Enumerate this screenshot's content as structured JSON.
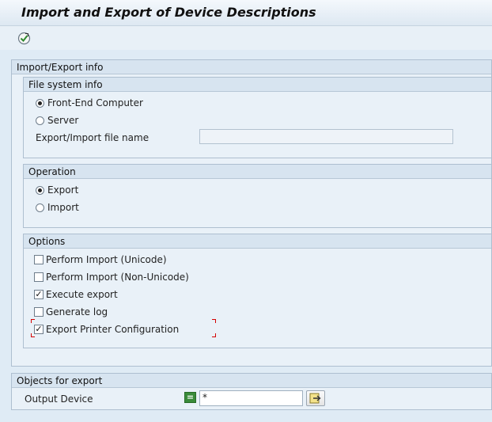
{
  "app": {
    "title": "Import and Export of Device Descriptions"
  },
  "toolbar": {
    "execute_icon": "execute-icon"
  },
  "import_export_info": {
    "title": "Import/Export info",
    "file_system_info": {
      "title": "File system info",
      "options": [
        {
          "label": "Front-End Computer",
          "selected": true
        },
        {
          "label": "Server",
          "selected": false
        }
      ],
      "file_name_label": "Export/Import file name",
      "file_name_value": ""
    },
    "operation": {
      "title": "Operation",
      "options": [
        {
          "label": "Export",
          "selected": true
        },
        {
          "label": "Import",
          "selected": false
        }
      ]
    },
    "options": {
      "title": "Options",
      "items": [
        {
          "label": "Perform Import (Unicode)",
          "checked": false
        },
        {
          "label": "Perform Import (Non-Unicode)",
          "checked": false
        },
        {
          "label": "Execute export",
          "checked": true
        },
        {
          "label": "Generate log",
          "checked": false
        },
        {
          "label": "Export Printer Configuration",
          "checked": true
        }
      ]
    }
  },
  "objects_for_export": {
    "title": "Objects for export",
    "output_device_label": "Output Device",
    "output_device_value": "*",
    "select_option_icon": "equals-icon",
    "multiple_selection_icon": "multiple-selection-arrow-icon"
  },
  "colors": {
    "background": "#dfebf5",
    "group_header": "#d7e4f0",
    "focus_marker": "#d40000",
    "option_icon_green": "#3a8b3a"
  }
}
